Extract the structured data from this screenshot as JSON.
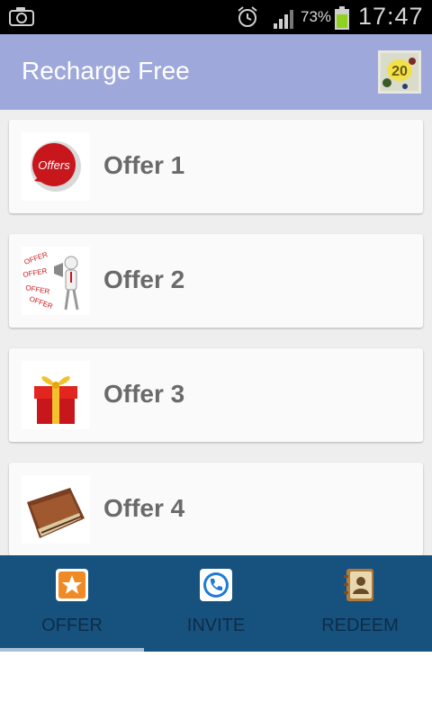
{
  "status_bar": {
    "battery_percent": "73%",
    "time": "17:47",
    "icons": [
      "camera-icon",
      "alarm-icon",
      "signal-icon",
      "battery-icon"
    ]
  },
  "action_bar": {
    "title": "Recharge Free",
    "icon": "app-logo-icon"
  },
  "offers": [
    {
      "label": "Offer 1",
      "icon": "offers-badge-icon"
    },
    {
      "label": "Offer 2",
      "icon": "megaphone-man-icon"
    },
    {
      "label": "Offer 3",
      "icon": "gift-box-icon"
    },
    {
      "label": "Offer 4",
      "icon": "wallet-icon"
    }
  ],
  "tabs": [
    {
      "label": "OFFER",
      "icon": "star-icon",
      "active": true
    },
    {
      "label": "INVITE",
      "icon": "phone-icon",
      "active": false
    },
    {
      "label": "REDEEM",
      "icon": "contacts-book-icon",
      "active": false
    }
  ],
  "colors": {
    "action_bar": "#9fa8da",
    "tab_bar": "#17527f",
    "list_background": "#eeeeee"
  }
}
